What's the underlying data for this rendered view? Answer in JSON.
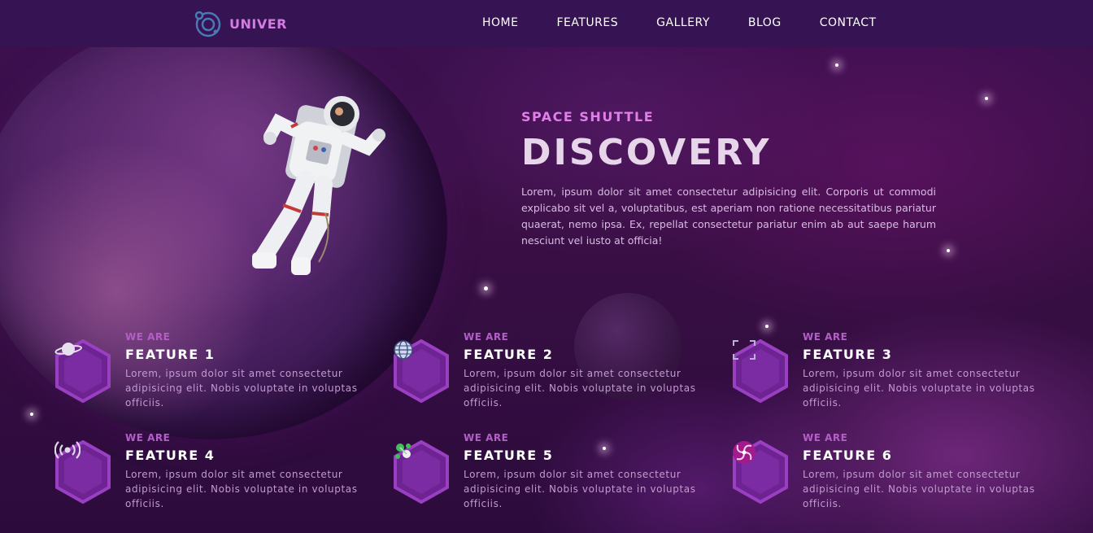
{
  "brand": {
    "name": "UNIVER"
  },
  "nav": {
    "items": [
      "HOME",
      "FEATURES",
      "GALLERY",
      "BLOG",
      "CONTACT"
    ]
  },
  "hero": {
    "subtitle": "SPACE SHUTTLE",
    "title": "DISCOVERY",
    "text": "Lorem, ipsum dolor sit amet consectetur adipisicing elit. Corporis ut commodi explicabo sit vel a, voluptatibus, est aperiam non ratione necessitatibus pariatur quaerat, nemo ipsa. Ex, repellat consectetur pariatur enim ab aut saepe harum nesciunt vel iusto at officia!"
  },
  "features": [
    {
      "kicker": "WE ARE",
      "title": "FEATURE 1",
      "icon": "planet-icon",
      "text": "Lorem, ipsum dolor sit amet consectetur adipisicing elit. Nobis voluptate in voluptas officiis."
    },
    {
      "kicker": "WE ARE",
      "title": "FEATURE 2",
      "icon": "globe-icon",
      "text": "Lorem, ipsum dolor sit amet consectetur adipisicing elit. Nobis voluptate in voluptas officiis."
    },
    {
      "kicker": "WE ARE",
      "title": "FEATURE 3",
      "icon": "frame-corners-icon",
      "text": "Lorem, ipsum dolor sit amet consectetur adipisicing elit. Nobis voluptate in voluptas officiis."
    },
    {
      "kicker": "WE ARE",
      "title": "FEATURE 4",
      "icon": "broadcast-icon",
      "text": "Lorem, ipsum dolor sit amet consectetur adipisicing elit. Nobis voluptate in voluptas officiis."
    },
    {
      "kicker": "WE ARE",
      "title": "FEATURE 5",
      "icon": "molecule-icon",
      "text": "Lorem, ipsum dolor sit amet consectetur adipisicing elit. Nobis voluptate in voluptas officiis."
    },
    {
      "kicker": "WE ARE",
      "title": "FEATURE 6",
      "icon": "spiral-galaxy-icon",
      "text": "Lorem, ipsum dolor sit amet consectetur adipisicing elit. Nobis voluptate in voluptas officiis."
    }
  ],
  "colors": {
    "nav_bg": "#361352",
    "accent": "#e07fe8",
    "hex_fill": "#7a2aa0",
    "hex_border": "#9b3fc2"
  }
}
